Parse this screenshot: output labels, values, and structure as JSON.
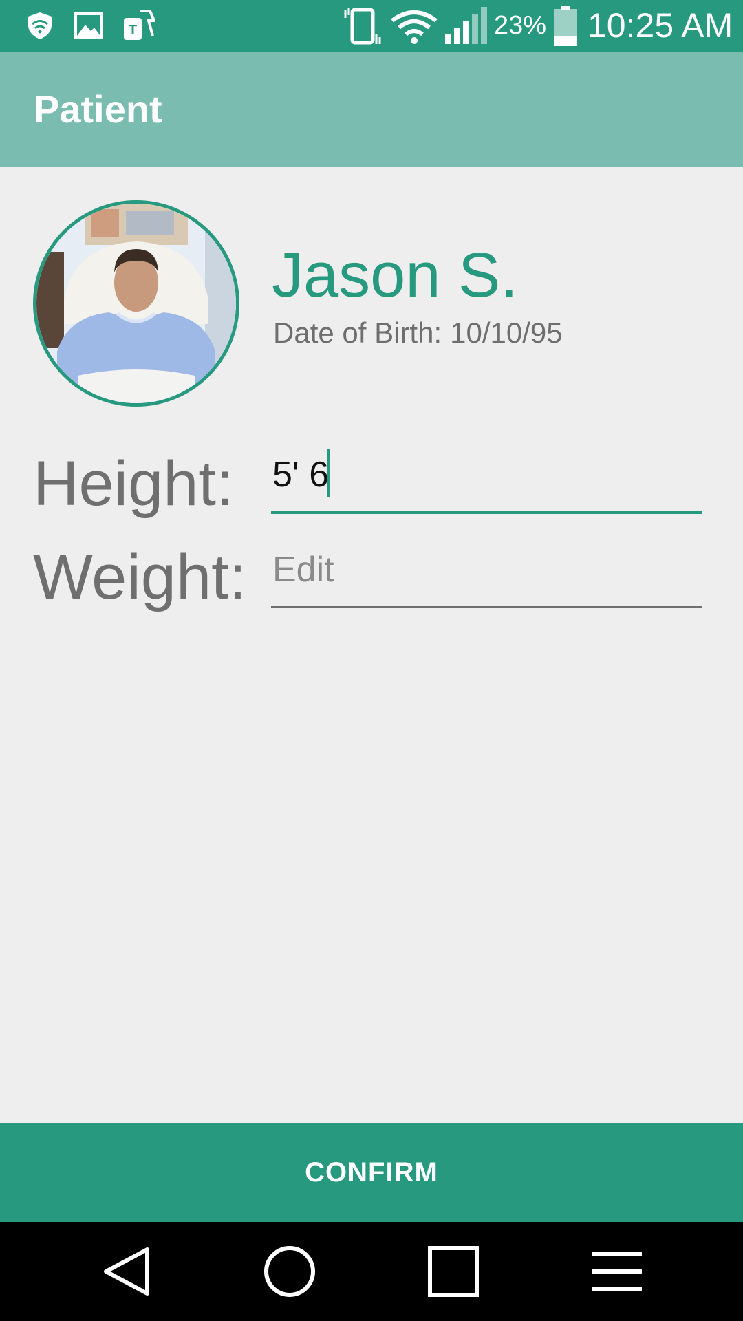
{
  "status_bar": {
    "battery_percent": "23%",
    "time": "10:25 AM",
    "battery_level": 0.23,
    "icons": [
      "vpn-shield-icon",
      "image-notification-icon",
      "carrier-app-icon",
      "vibrate-icon",
      "wifi-icon",
      "cell-signal-icon",
      "battery-icon"
    ]
  },
  "app_bar": {
    "title": "Patient"
  },
  "patient": {
    "name": "Jason S.",
    "dob_label": "Date of Birth:",
    "dob": "10/10/95",
    "photo_icon": "patient-photo"
  },
  "form": {
    "height_label": "Height:",
    "height_value": "5' 6",
    "weight_label": "Weight:",
    "weight_placeholder": "Edit",
    "weight_value": ""
  },
  "confirm": {
    "label": "CONFIRM"
  },
  "nav_bar": {
    "icons": [
      "back-icon",
      "home-icon",
      "recents-icon",
      "menu-icon"
    ]
  },
  "colors": {
    "primary": "#26997f",
    "app_bar": "#7abcb0",
    "background": "#eeeeee",
    "secondary_text": "#6f6f6f"
  }
}
